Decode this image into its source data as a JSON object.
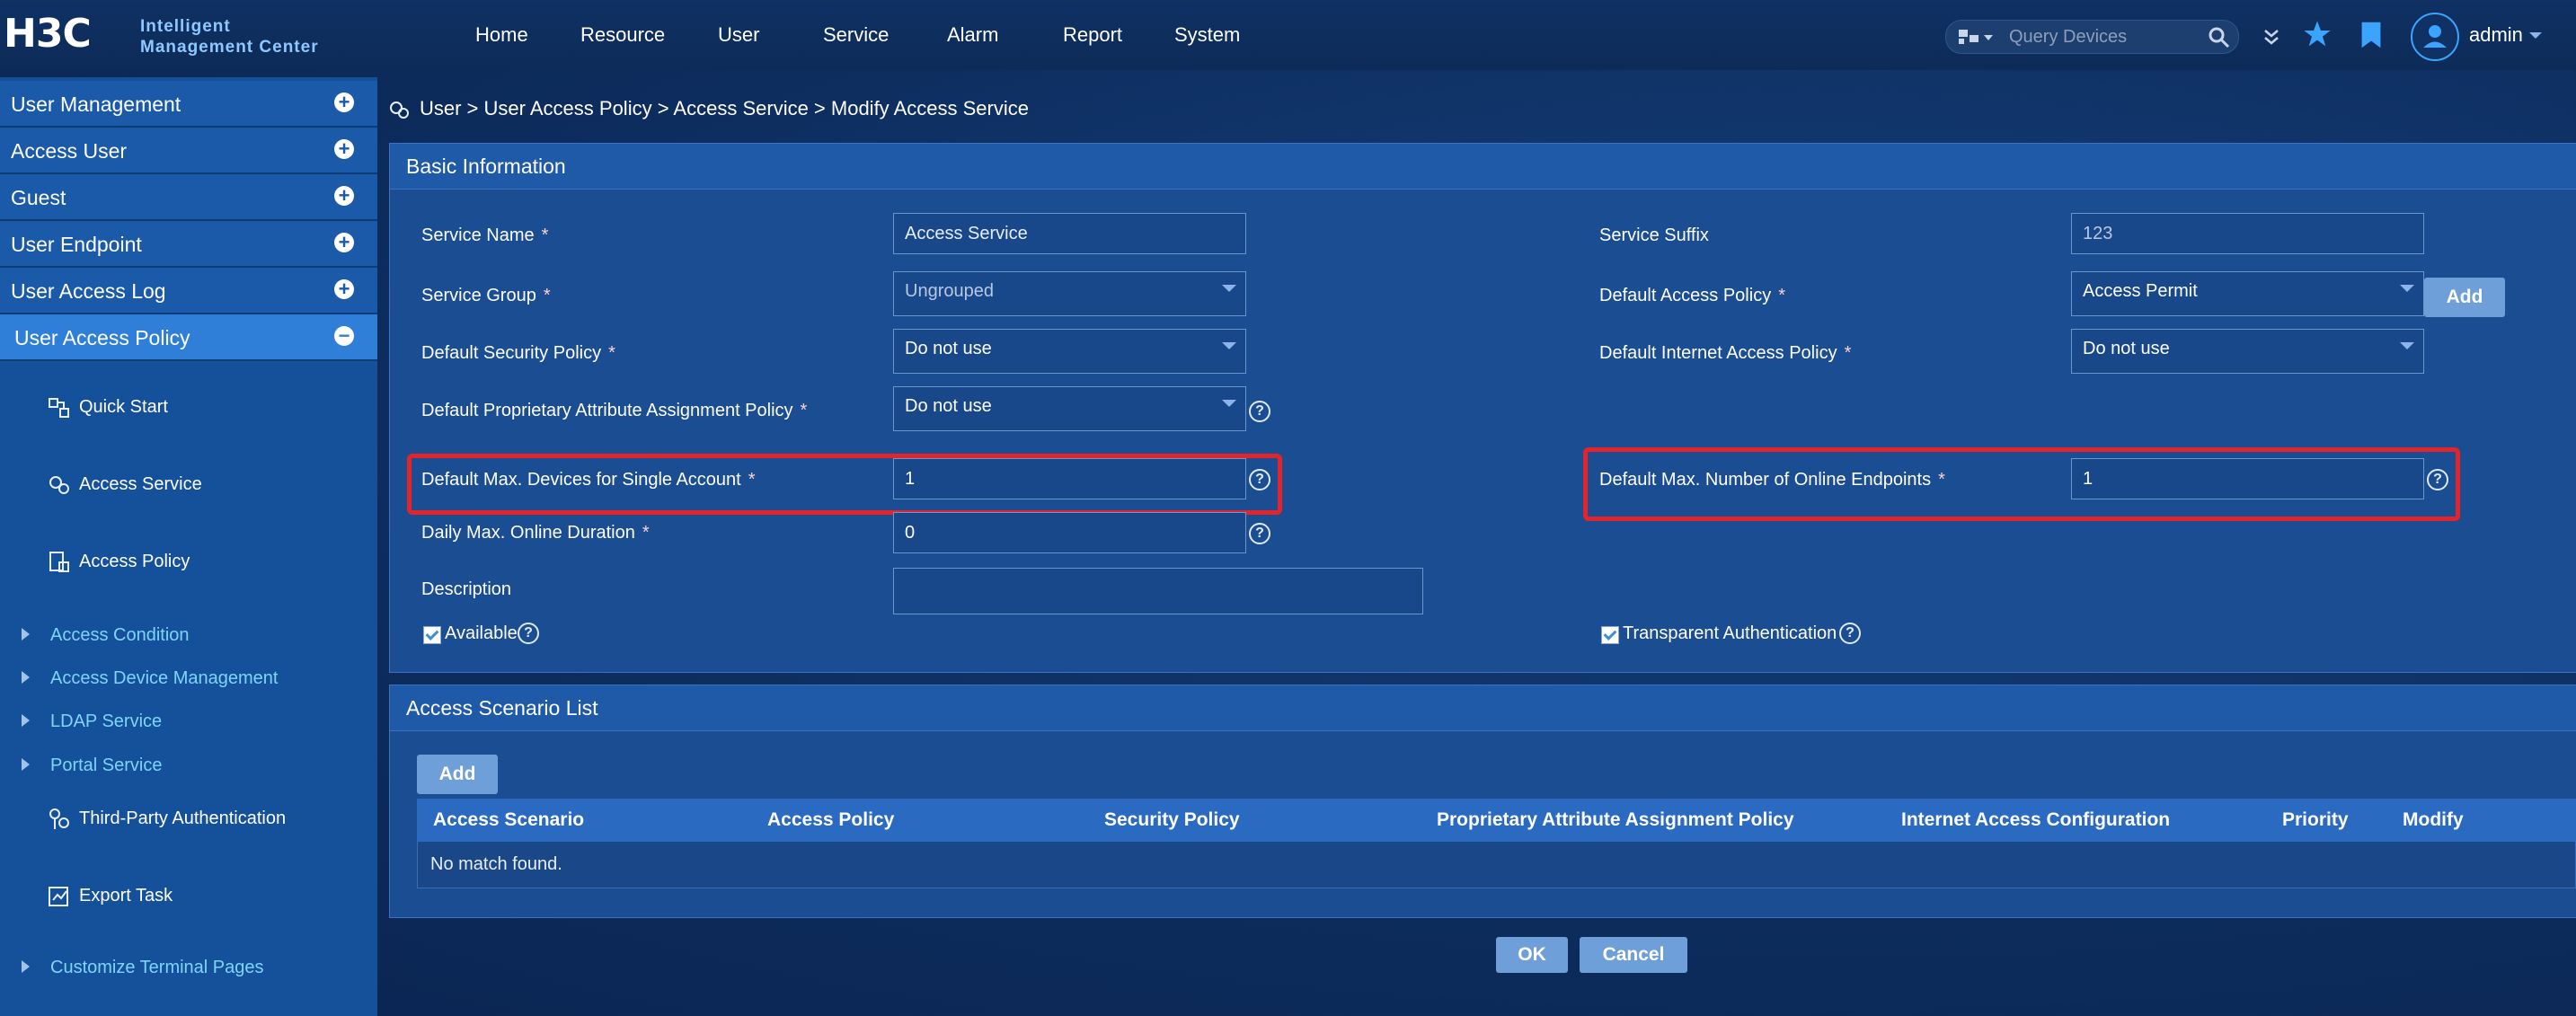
{
  "header": {
    "logo": "H3C",
    "logo_sub_line1": "Intelligent",
    "logo_sub_line2": "Management Center",
    "nav": [
      "Home",
      "Resource",
      "User",
      "Service",
      "Alarm",
      "Report",
      "System"
    ],
    "search_placeholder": "Query Devices",
    "user": "admin"
  },
  "sidebar": {
    "menus": [
      {
        "label": "User Management"
      },
      {
        "label": "Access User"
      },
      {
        "label": "Guest"
      },
      {
        "label": "User Endpoint"
      },
      {
        "label": "User Access Log"
      },
      {
        "label": "User Access Policy"
      }
    ],
    "items": [
      {
        "label": "Quick Start"
      },
      {
        "label": "Access Service"
      },
      {
        "label": "Access Policy"
      }
    ],
    "links": [
      {
        "label": "Access Condition"
      },
      {
        "label": "Access Device Management"
      },
      {
        "label": "LDAP Service"
      },
      {
        "label": "Portal Service"
      }
    ],
    "items2": [
      {
        "label": "Third-Party Authentication"
      },
      {
        "label": "Export Task"
      }
    ],
    "links2": [
      {
        "label": "Customize Terminal Pages"
      }
    ]
  },
  "breadcrumb": "User > User Access Policy > Access Service > Modify Access Service",
  "basic": {
    "title": "Basic Information",
    "service_name_label": "Service Name",
    "service_name": "Access Service",
    "service_suffix_label": "Service Suffix",
    "service_suffix": "123",
    "service_group_label": "Service Group",
    "service_group": "Ungrouped",
    "default_access_policy_label": "Default Access Policy",
    "default_access_policy": "Access Permit",
    "add_label": "Add",
    "default_security_policy_label": "Default Security Policy",
    "default_security_policy": "Do not use",
    "default_internet_policy_label": "Default Internet Access Policy",
    "default_internet_policy": "Do not use",
    "default_proprietary_label": "Default Proprietary Attribute Assignment Policy",
    "default_proprietary": "Do not use",
    "max_devices_label": "Default Max. Devices for Single Account",
    "max_devices": "1",
    "max_online_label": "Default Max. Number of Online Endpoints",
    "max_online": "1",
    "daily_max_label": "Daily Max. Online Duration",
    "daily_max": "0",
    "description_label": "Description",
    "description": "",
    "available_label": "Available",
    "transparent_label": "Transparent Authentication",
    "required_mark": "*",
    "help_mark": "?"
  },
  "scenario": {
    "title": "Access Scenario List",
    "add_label": "Add",
    "columns": [
      "Access Scenario",
      "Access Policy",
      "Security Policy",
      "Proprietary Attribute Assignment Policy",
      "Internet Access Configuration",
      "Priority",
      "Modify"
    ],
    "empty": "No match found."
  },
  "footer": {
    "ok": "OK",
    "cancel": "Cancel"
  }
}
